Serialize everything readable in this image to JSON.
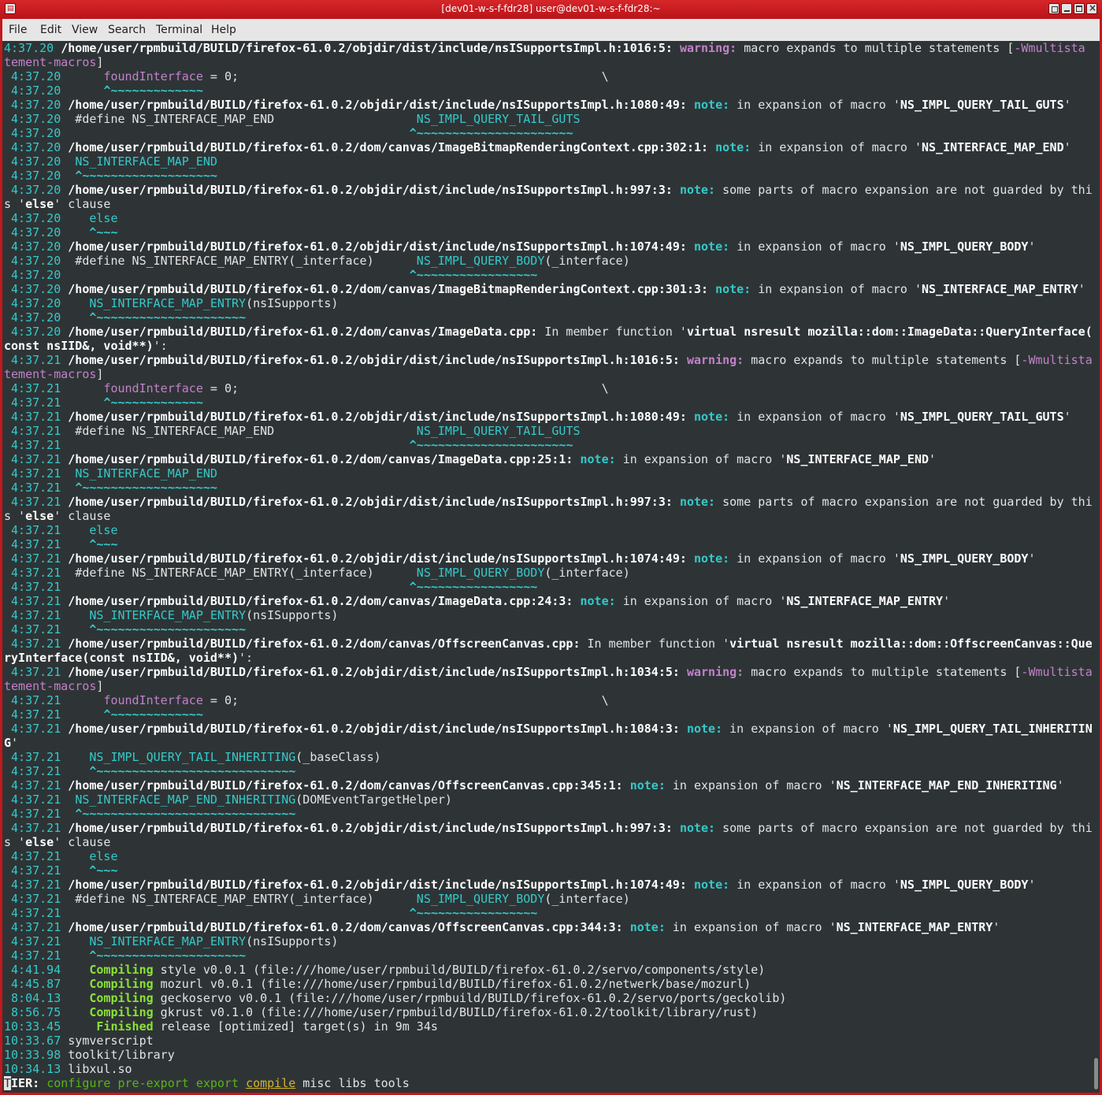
{
  "window": {
    "title": "[dev01-w-s-f-fdr28] user@dev01-w-s-f-fdr28:~",
    "app_icon": "terminal-icon",
    "controls": [
      "pin-icon",
      "minimize-icon",
      "maximize-icon",
      "close-icon"
    ]
  },
  "menu": [
    "File",
    "Edit",
    "View",
    "Search",
    "Terminal",
    "Help"
  ],
  "lines": [
    [
      [
        "4:37.20 ",
        "ts"
      ],
      [
        "/home/user/rpmbuild/BUILD/firefox-61.0.2/objdir/dist/include/nsISupportsImpl.h:1016:5: ",
        "b"
      ],
      [
        "warning: ",
        "warn"
      ],
      [
        "macro expands to multiple statements [",
        ""
      ],
      [
        "-Wmultista",
        "pk"
      ]
    ],
    [
      [
        "tement-macros",
        "pk"
      ],
      [
        "]",
        ""
      ]
    ],
    [
      [
        " 4:37.20 ",
        "ts"
      ],
      [
        "     ",
        ""
      ],
      [
        "foundInterface",
        "pk"
      ],
      [
        " = 0;                                                   \\",
        ""
      ]
    ],
    [
      [
        " 4:37.20 ",
        "ts"
      ],
      [
        "     ",
        ""
      ],
      [
        "^~~~~~~~~~~~~~",
        "car"
      ]
    ],
    [
      [
        " 4:37.20 ",
        "ts"
      ],
      [
        "/home/user/rpmbuild/BUILD/firefox-61.0.2/objdir/dist/include/nsISupportsImpl.h:1080:49: ",
        "b"
      ],
      [
        "note: ",
        "note"
      ],
      [
        "in expansion of macro '",
        ""
      ],
      [
        "NS_IMPL_QUERY_TAIL_GUTS",
        "b"
      ],
      [
        "'",
        ""
      ]
    ],
    [
      [
        " 4:37.20 ",
        "ts"
      ],
      [
        " #define NS_INTERFACE_MAP_END                    ",
        ""
      ],
      [
        "NS_IMPL_QUERY_TAIL_GUTS",
        "mac"
      ]
    ],
    [
      [
        " 4:37.20 ",
        "ts"
      ],
      [
        "                                                ",
        ""
      ],
      [
        "^~~~~~~~~~~~~~~~~~~~~~~",
        "car"
      ]
    ],
    [
      [
        " 4:37.20 ",
        "ts"
      ],
      [
        "/home/user/rpmbuild/BUILD/firefox-61.0.2/dom/canvas/ImageBitmapRenderingContext.cpp:302:1: ",
        "b"
      ],
      [
        "note: ",
        "note"
      ],
      [
        "in expansion of macro '",
        ""
      ],
      [
        "NS_INTERFACE_MAP_END",
        "b"
      ],
      [
        "'",
        ""
      ]
    ],
    [
      [
        " 4:37.20 ",
        "ts"
      ],
      [
        " ",
        ""
      ],
      [
        "NS_INTERFACE_MAP_END",
        "mac"
      ]
    ],
    [
      [
        " 4:37.20 ",
        "ts"
      ],
      [
        " ",
        ""
      ],
      [
        "^~~~~~~~~~~~~~~~~~~~",
        "car"
      ]
    ],
    [
      [
        " 4:37.20 ",
        "ts"
      ],
      [
        "/home/user/rpmbuild/BUILD/firefox-61.0.2/objdir/dist/include/nsISupportsImpl.h:997:3: ",
        "b"
      ],
      [
        "note: ",
        "note"
      ],
      [
        "some parts of macro expansion are not guarded by thi",
        ""
      ]
    ],
    [
      [
        "s '",
        ""
      ],
      [
        "else",
        "b"
      ],
      [
        "' clause",
        ""
      ]
    ],
    [
      [
        " 4:37.20 ",
        "ts"
      ],
      [
        "   ",
        ""
      ],
      [
        "else",
        "mac"
      ]
    ],
    [
      [
        " 4:37.20 ",
        "ts"
      ],
      [
        "   ",
        ""
      ],
      [
        "^~~~",
        "car"
      ]
    ],
    [
      [
        " 4:37.20 ",
        "ts"
      ],
      [
        "/home/user/rpmbuild/BUILD/firefox-61.0.2/objdir/dist/include/nsISupportsImpl.h:1074:49: ",
        "b"
      ],
      [
        "note: ",
        "note"
      ],
      [
        "in expansion of macro '",
        ""
      ],
      [
        "NS_IMPL_QUERY_BODY",
        "b"
      ],
      [
        "'",
        ""
      ]
    ],
    [
      [
        " 4:37.20 ",
        "ts"
      ],
      [
        " #define NS_INTERFACE_MAP_ENTRY(_interface)      ",
        ""
      ],
      [
        "NS_IMPL_QUERY_BODY",
        "mac"
      ],
      [
        "(_interface)",
        ""
      ]
    ],
    [
      [
        " 4:37.20 ",
        "ts"
      ],
      [
        "                                                ",
        ""
      ],
      [
        "^~~~~~~~~~~~~~~~~~",
        "car"
      ]
    ],
    [
      [
        " 4:37.20 ",
        "ts"
      ],
      [
        "/home/user/rpmbuild/BUILD/firefox-61.0.2/dom/canvas/ImageBitmapRenderingContext.cpp:301:3: ",
        "b"
      ],
      [
        "note: ",
        "note"
      ],
      [
        "in expansion of macro '",
        ""
      ],
      [
        "NS_INTERFACE_MAP_ENTRY",
        "b"
      ],
      [
        "'",
        ""
      ]
    ],
    [
      [
        " 4:37.20 ",
        "ts"
      ],
      [
        "   ",
        ""
      ],
      [
        "NS_INTERFACE_MAP_ENTRY",
        "mac"
      ],
      [
        "(nsISupports)",
        ""
      ]
    ],
    [
      [
        " 4:37.20 ",
        "ts"
      ],
      [
        "   ",
        ""
      ],
      [
        "^~~~~~~~~~~~~~~~~~~~~~",
        "car"
      ]
    ],
    [
      [
        " 4:37.20 ",
        "ts"
      ],
      [
        "/home/user/rpmbuild/BUILD/firefox-61.0.2/dom/canvas/ImageData.cpp: ",
        "b"
      ],
      [
        "In member function '",
        ""
      ],
      [
        "virtual nsresult mozilla::dom::ImageData::QueryInterface(",
        "b"
      ]
    ],
    [
      [
        "const nsIID&, void**)",
        "b"
      ],
      [
        "':",
        ""
      ]
    ],
    [
      [
        " 4:37.21 ",
        "ts"
      ],
      [
        "/home/user/rpmbuild/BUILD/firefox-61.0.2/objdir/dist/include/nsISupportsImpl.h:1016:5: ",
        "b"
      ],
      [
        "warning: ",
        "warn"
      ],
      [
        "macro expands to multiple statements [",
        ""
      ],
      [
        "-Wmultista",
        "pk"
      ]
    ],
    [
      [
        "tement-macros",
        "pk"
      ],
      [
        "]",
        ""
      ]
    ],
    [
      [
        " 4:37.21 ",
        "ts"
      ],
      [
        "     ",
        ""
      ],
      [
        "foundInterface",
        "pk"
      ],
      [
        " = 0;                                                   \\",
        ""
      ]
    ],
    [
      [
        " 4:37.21 ",
        "ts"
      ],
      [
        "     ",
        ""
      ],
      [
        "^~~~~~~~~~~~~~",
        "car"
      ]
    ],
    [
      [
        " 4:37.21 ",
        "ts"
      ],
      [
        "/home/user/rpmbuild/BUILD/firefox-61.0.2/objdir/dist/include/nsISupportsImpl.h:1080:49: ",
        "b"
      ],
      [
        "note: ",
        "note"
      ],
      [
        "in expansion of macro '",
        ""
      ],
      [
        "NS_IMPL_QUERY_TAIL_GUTS",
        "b"
      ],
      [
        "'",
        ""
      ]
    ],
    [
      [
        " 4:37.21 ",
        "ts"
      ],
      [
        " #define NS_INTERFACE_MAP_END                    ",
        ""
      ],
      [
        "NS_IMPL_QUERY_TAIL_GUTS",
        "mac"
      ]
    ],
    [
      [
        " 4:37.21 ",
        "ts"
      ],
      [
        "                                                ",
        ""
      ],
      [
        "^~~~~~~~~~~~~~~~~~~~~~~",
        "car"
      ]
    ],
    [
      [
        " 4:37.21 ",
        "ts"
      ],
      [
        "/home/user/rpmbuild/BUILD/firefox-61.0.2/dom/canvas/ImageData.cpp:25:1: ",
        "b"
      ],
      [
        "note: ",
        "note"
      ],
      [
        "in expansion of macro '",
        ""
      ],
      [
        "NS_INTERFACE_MAP_END",
        "b"
      ],
      [
        "'",
        ""
      ]
    ],
    [
      [
        " 4:37.21 ",
        "ts"
      ],
      [
        " ",
        ""
      ],
      [
        "NS_INTERFACE_MAP_END",
        "mac"
      ]
    ],
    [
      [
        " 4:37.21 ",
        "ts"
      ],
      [
        " ",
        ""
      ],
      [
        "^~~~~~~~~~~~~~~~~~~~",
        "car"
      ]
    ],
    [
      [
        " 4:37.21 ",
        "ts"
      ],
      [
        "/home/user/rpmbuild/BUILD/firefox-61.0.2/objdir/dist/include/nsISupportsImpl.h:997:3: ",
        "b"
      ],
      [
        "note: ",
        "note"
      ],
      [
        "some parts of macro expansion are not guarded by thi",
        ""
      ]
    ],
    [
      [
        "s '",
        ""
      ],
      [
        "else",
        "b"
      ],
      [
        "' clause",
        ""
      ]
    ],
    [
      [
        " 4:37.21 ",
        "ts"
      ],
      [
        "   ",
        ""
      ],
      [
        "else",
        "mac"
      ]
    ],
    [
      [
        " 4:37.21 ",
        "ts"
      ],
      [
        "   ",
        ""
      ],
      [
        "^~~~",
        "car"
      ]
    ],
    [
      [
        " 4:37.21 ",
        "ts"
      ],
      [
        "/home/user/rpmbuild/BUILD/firefox-61.0.2/objdir/dist/include/nsISupportsImpl.h:1074:49: ",
        "b"
      ],
      [
        "note: ",
        "note"
      ],
      [
        "in expansion of macro '",
        ""
      ],
      [
        "NS_IMPL_QUERY_BODY",
        "b"
      ],
      [
        "'",
        ""
      ]
    ],
    [
      [
        " 4:37.21 ",
        "ts"
      ],
      [
        " #define NS_INTERFACE_MAP_ENTRY(_interface)      ",
        ""
      ],
      [
        "NS_IMPL_QUERY_BODY",
        "mac"
      ],
      [
        "(_interface)",
        ""
      ]
    ],
    [
      [
        " 4:37.21 ",
        "ts"
      ],
      [
        "                                                ",
        ""
      ],
      [
        "^~~~~~~~~~~~~~~~~~",
        "car"
      ]
    ],
    [
      [
        " 4:37.21 ",
        "ts"
      ],
      [
        "/home/user/rpmbuild/BUILD/firefox-61.0.2/dom/canvas/ImageData.cpp:24:3: ",
        "b"
      ],
      [
        "note: ",
        "note"
      ],
      [
        "in expansion of macro '",
        ""
      ],
      [
        "NS_INTERFACE_MAP_ENTRY",
        "b"
      ],
      [
        "'",
        ""
      ]
    ],
    [
      [
        " 4:37.21 ",
        "ts"
      ],
      [
        "   ",
        ""
      ],
      [
        "NS_INTERFACE_MAP_ENTRY",
        "mac"
      ],
      [
        "(nsISupports)",
        ""
      ]
    ],
    [
      [
        " 4:37.21 ",
        "ts"
      ],
      [
        "   ",
        ""
      ],
      [
        "^~~~~~~~~~~~~~~~~~~~~~",
        "car"
      ]
    ],
    [
      [
        " 4:37.21 ",
        "ts"
      ],
      [
        "/home/user/rpmbuild/BUILD/firefox-61.0.2/dom/canvas/OffscreenCanvas.cpp: ",
        "b"
      ],
      [
        "In member function '",
        ""
      ],
      [
        "virtual nsresult mozilla::dom::OffscreenCanvas::Que",
        "b"
      ]
    ],
    [
      [
        "ryInterface(const nsIID&, void**)",
        "b"
      ],
      [
        "':",
        ""
      ]
    ],
    [
      [
        " 4:37.21 ",
        "ts"
      ],
      [
        "/home/user/rpmbuild/BUILD/firefox-61.0.2/objdir/dist/include/nsISupportsImpl.h:1034:5: ",
        "b"
      ],
      [
        "warning: ",
        "warn"
      ],
      [
        "macro expands to multiple statements [",
        ""
      ],
      [
        "-Wmultista",
        "pk"
      ]
    ],
    [
      [
        "tement-macros",
        "pk"
      ],
      [
        "]",
        ""
      ]
    ],
    [
      [
        " 4:37.21 ",
        "ts"
      ],
      [
        "     ",
        ""
      ],
      [
        "foundInterface",
        "pk"
      ],
      [
        " = 0;                                                   \\",
        ""
      ]
    ],
    [
      [
        " 4:37.21 ",
        "ts"
      ],
      [
        "     ",
        ""
      ],
      [
        "^~~~~~~~~~~~~~",
        "car"
      ]
    ],
    [
      [
        " 4:37.21 ",
        "ts"
      ],
      [
        "/home/user/rpmbuild/BUILD/firefox-61.0.2/objdir/dist/include/nsISupportsImpl.h:1084:3: ",
        "b"
      ],
      [
        "note: ",
        "note"
      ],
      [
        "in expansion of macro '",
        ""
      ],
      [
        "NS_IMPL_QUERY_TAIL_INHERITIN",
        "b"
      ]
    ],
    [
      [
        "G",
        "b"
      ],
      [
        "'",
        ""
      ]
    ],
    [
      [
        " 4:37.21 ",
        "ts"
      ],
      [
        "   ",
        ""
      ],
      [
        "NS_IMPL_QUERY_TAIL_INHERITING",
        "mac"
      ],
      [
        "(_baseClass)",
        ""
      ]
    ],
    [
      [
        " 4:37.21 ",
        "ts"
      ],
      [
        "   ",
        ""
      ],
      [
        "^~~~~~~~~~~~~~~~~~~~~~~~~~~~~",
        "car"
      ]
    ],
    [
      [
        " 4:37.21 ",
        "ts"
      ],
      [
        "/home/user/rpmbuild/BUILD/firefox-61.0.2/dom/canvas/OffscreenCanvas.cpp:345:1: ",
        "b"
      ],
      [
        "note: ",
        "note"
      ],
      [
        "in expansion of macro '",
        ""
      ],
      [
        "NS_INTERFACE_MAP_END_INHERITING",
        "b"
      ],
      [
        "'",
        ""
      ]
    ],
    [
      [
        " 4:37.21 ",
        "ts"
      ],
      [
        " ",
        ""
      ],
      [
        "NS_INTERFACE_MAP_END_INHERITING",
        "mac"
      ],
      [
        "(DOMEventTargetHelper)",
        ""
      ]
    ],
    [
      [
        " 4:37.21 ",
        "ts"
      ],
      [
        " ",
        ""
      ],
      [
        "^~~~~~~~~~~~~~~~~~~~~~~~~~~~~~~",
        "car"
      ]
    ],
    [
      [
        " 4:37.21 ",
        "ts"
      ],
      [
        "/home/user/rpmbuild/BUILD/firefox-61.0.2/objdir/dist/include/nsISupportsImpl.h:997:3: ",
        "b"
      ],
      [
        "note: ",
        "note"
      ],
      [
        "some parts of macro expansion are not guarded by thi",
        ""
      ]
    ],
    [
      [
        "s '",
        ""
      ],
      [
        "else",
        "b"
      ],
      [
        "' clause",
        ""
      ]
    ],
    [
      [
        " 4:37.21 ",
        "ts"
      ],
      [
        "   ",
        ""
      ],
      [
        "else",
        "mac"
      ]
    ],
    [
      [
        " 4:37.21 ",
        "ts"
      ],
      [
        "   ",
        ""
      ],
      [
        "^~~~",
        "car"
      ]
    ],
    [
      [
        " 4:37.21 ",
        "ts"
      ],
      [
        "/home/user/rpmbuild/BUILD/firefox-61.0.2/objdir/dist/include/nsISupportsImpl.h:1074:49: ",
        "b"
      ],
      [
        "note: ",
        "note"
      ],
      [
        "in expansion of macro '",
        ""
      ],
      [
        "NS_IMPL_QUERY_BODY",
        "b"
      ],
      [
        "'",
        ""
      ]
    ],
    [
      [
        " 4:37.21 ",
        "ts"
      ],
      [
        " #define NS_INTERFACE_MAP_ENTRY(_interface)      ",
        ""
      ],
      [
        "NS_IMPL_QUERY_BODY",
        "mac"
      ],
      [
        "(_interface)",
        ""
      ]
    ],
    [
      [
        " 4:37.21 ",
        "ts"
      ],
      [
        "                                                ",
        ""
      ],
      [
        "^~~~~~~~~~~~~~~~~~",
        "car"
      ]
    ],
    [
      [
        " 4:37.21 ",
        "ts"
      ],
      [
        "/home/user/rpmbuild/BUILD/firefox-61.0.2/dom/canvas/OffscreenCanvas.cpp:344:3: ",
        "b"
      ],
      [
        "note: ",
        "note"
      ],
      [
        "in expansion of macro '",
        ""
      ],
      [
        "NS_INTERFACE_MAP_ENTRY",
        "b"
      ],
      [
        "'",
        ""
      ]
    ],
    [
      [
        " 4:37.21 ",
        "ts"
      ],
      [
        "   ",
        ""
      ],
      [
        "NS_INTERFACE_MAP_ENTRY",
        "mac"
      ],
      [
        "(nsISupports)",
        ""
      ]
    ],
    [
      [
        " 4:37.21 ",
        "ts"
      ],
      [
        "   ",
        ""
      ],
      [
        "^~~~~~~~~~~~~~~~~~~~~~",
        "car"
      ]
    ],
    [
      [
        " 4:41.94 ",
        "ts"
      ],
      [
        "   ",
        ""
      ],
      [
        "Compiling",
        "comp"
      ],
      [
        " style v0.0.1 (file:///home/user/rpmbuild/BUILD/firefox-61.0.2/servo/components/style)",
        ""
      ]
    ],
    [
      [
        " 4:45.87 ",
        "ts"
      ],
      [
        "   ",
        ""
      ],
      [
        "Compiling",
        "comp"
      ],
      [
        " mozurl v0.0.1 (file:///home/user/rpmbuild/BUILD/firefox-61.0.2/netwerk/base/mozurl)",
        ""
      ]
    ],
    [
      [
        " 8:04.13 ",
        "ts"
      ],
      [
        "   ",
        ""
      ],
      [
        "Compiling",
        "comp"
      ],
      [
        " geckoservo v0.0.1 (file:///home/user/rpmbuild/BUILD/firefox-61.0.2/servo/ports/geckolib)",
        ""
      ]
    ],
    [
      [
        " 8:56.75 ",
        "ts"
      ],
      [
        "   ",
        ""
      ],
      [
        "Compiling",
        "comp"
      ],
      [
        " gkrust v0.1.0 (file:///home/user/rpmbuild/BUILD/firefox-61.0.2/toolkit/library/rust)",
        ""
      ]
    ],
    [
      [
        "10:33.45 ",
        "ts"
      ],
      [
        "    ",
        ""
      ],
      [
        "Finished",
        "comp"
      ],
      [
        " release [optimized] target(s) in 9m 34s",
        ""
      ]
    ],
    [
      [
        "10:33.67 ",
        "ts"
      ],
      [
        "symverscript",
        ""
      ]
    ],
    [
      [
        "10:33.98 ",
        "ts"
      ],
      [
        "toolkit/library",
        ""
      ]
    ],
    [
      [
        "10:34.13 ",
        "ts"
      ],
      [
        "libxul.so",
        ""
      ]
    ],
    [
      [
        "T",
        "cur"
      ],
      [
        "IER: ",
        "b"
      ],
      [
        "configure pre-export export ",
        "grn"
      ],
      [
        "compile",
        "yel"
      ],
      [
        " misc libs tools",
        ""
      ]
    ]
  ]
}
